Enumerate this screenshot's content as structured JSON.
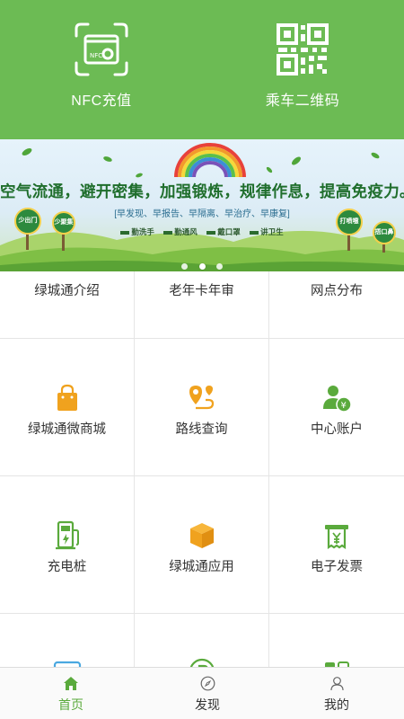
{
  "header": {
    "nfc_label": "NFC充值",
    "qr_label": "乘车二维码",
    "nfc_card_text": "NFC",
    "accent": "#6cbb54"
  },
  "banner": {
    "slogan": "空气流通，避开密集，加强锻炼，规律作息，提高免疫力。",
    "sub": "[早发现、早报告、早隔离、早治疗、早康复]",
    "tips": [
      "勤洗手",
      "勤通风",
      "戴口罩",
      "讲卫生"
    ],
    "signs": [
      "少出门",
      "少聚集",
      "打喷嚏",
      "捂口鼻"
    ],
    "slide_count": 3,
    "active_slide": 2
  },
  "grid": {
    "items": [
      {
        "label": "绿城通介绍",
        "icon": "info-icon"
      },
      {
        "label": "老年卡年审",
        "icon": "elder-card-icon"
      },
      {
        "label": "网点分布",
        "icon": "location-network-icon"
      },
      {
        "label": "绿城通微商城",
        "icon": "shopping-bag-icon"
      },
      {
        "label": "路线查询",
        "icon": "route-icon"
      },
      {
        "label": "中心账户",
        "icon": "account-icon"
      },
      {
        "label": "充电桩",
        "icon": "charging-pile-icon"
      },
      {
        "label": "绿城通应用",
        "icon": "box-icon"
      },
      {
        "label": "电子发票",
        "icon": "invoice-icon"
      },
      {
        "label": "",
        "icon": "card-icon"
      },
      {
        "label": "",
        "icon": "parking-icon"
      },
      {
        "label": "",
        "icon": "apps-icon"
      }
    ]
  },
  "tabbar": {
    "home": "首页",
    "discover": "发现",
    "mine": "我的",
    "active_color": "#5aaa3c"
  }
}
